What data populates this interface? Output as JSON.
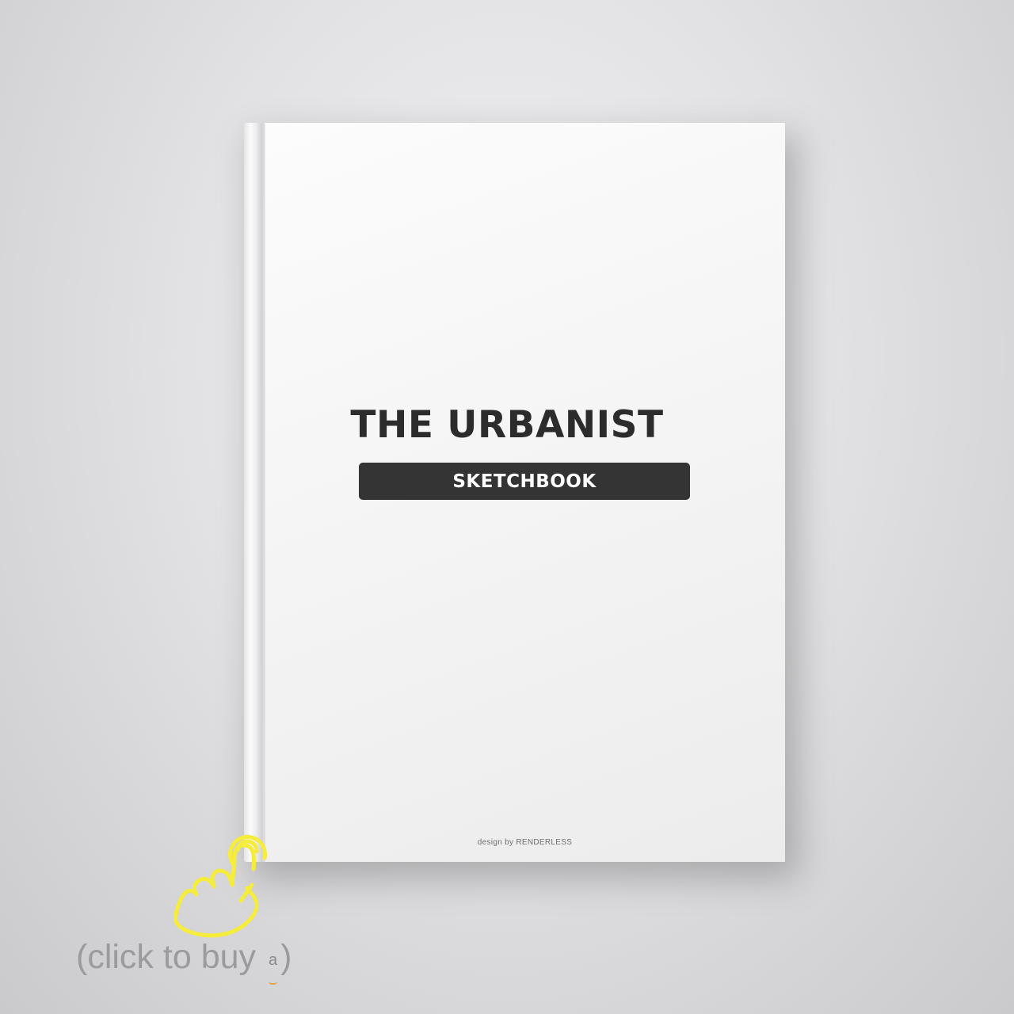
{
  "book": {
    "title": "THE URBANIST",
    "subtitle": "SKETCHBOOK",
    "credit": "design by RENDERLESS"
  },
  "cta": {
    "open_paren": "(",
    "label": "click to buy",
    "logo_letter": "a",
    "close_paren": ")",
    "hand_icon": "pointing-hand-click-icon",
    "logo_icon": "amazon-logo-icon"
  },
  "colors": {
    "hand": "#f5ec3c",
    "title": "#2c2c2c",
    "subtitle_bar": "#343434",
    "cta_text": "#9b9b9d"
  }
}
